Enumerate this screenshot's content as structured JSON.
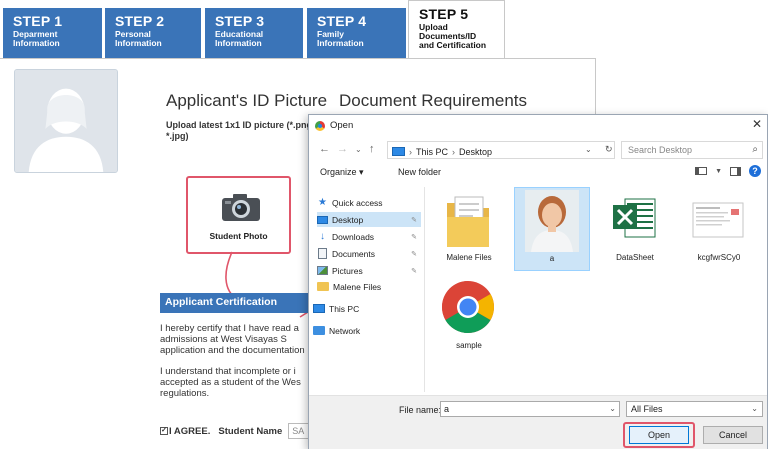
{
  "steps": [
    {
      "num": "STEP 1",
      "sub": "Deparment\nInformation"
    },
    {
      "num": "STEP 2",
      "sub": "Personal\nInformation"
    },
    {
      "num": "STEP 3",
      "sub": "Educational\nInformation"
    },
    {
      "num": "STEP 4",
      "sub": "Family\nInformation"
    },
    {
      "num": "STEP 5",
      "sub": "Upload\nDocuments/ID\nand Certification"
    }
  ],
  "headings": {
    "id_picture": "Applicant's ID Picture",
    "document_requirements": "Document Requirements"
  },
  "upload_note": "Upload latest 1x1 ID picture (*.png, *.jpg)",
  "student_photo_label": "Student Photo",
  "certification": {
    "title": "Applicant Certification",
    "p1": "I hereby certify that I have read a\nadmissions at West Visayas S\napplication and the documentation",
    "p2": "I understand that incomplete or i\naccepted as a student of the Wes\nregulations.",
    "agree": "I AGREE.",
    "student_name_label": "Student Name",
    "student_name_value": "SA"
  },
  "dialog": {
    "title": "Open",
    "nav": {
      "back": "←",
      "forward": "→",
      "dropdown": "⌄",
      "up": "↑"
    },
    "breadcrumb": [
      "This PC",
      "Desktop"
    ],
    "search_placeholder": "Search Desktop",
    "organize": "Organize ▾",
    "new_folder": "New folder",
    "sidebar": [
      {
        "label": "Quick access",
        "icon": "star-icon",
        "pinned": false
      },
      {
        "label": "Desktop",
        "icon": "desktop-icon",
        "pinned": true
      },
      {
        "label": "Downloads",
        "icon": "downloads-icon",
        "pinned": true
      },
      {
        "label": "Documents",
        "icon": "documents-icon",
        "pinned": true
      },
      {
        "label": "Pictures",
        "icon": "pictures-icon",
        "pinned": true
      },
      {
        "label": "Malene Files",
        "icon": "folder-icon",
        "pinned": false
      },
      {
        "label": "This PC",
        "icon": "pc-icon",
        "pinned": false
      },
      {
        "label": "Network",
        "icon": "network-icon",
        "pinned": false
      }
    ],
    "files": [
      {
        "name": "Malene Files",
        "type": "folder"
      },
      {
        "name": "a",
        "type": "photo",
        "selected": true
      },
      {
        "name": "DataSheet",
        "type": "excel"
      },
      {
        "name": "kcgfwrSCy0",
        "type": "document"
      },
      {
        "name": "sample",
        "type": "chrome"
      }
    ],
    "file_name_label": "File name:",
    "file_name_value": "a",
    "file_type": "All Files",
    "open_label": "Open",
    "cancel_label": "Cancel"
  },
  "colors": {
    "step_blue": "#3a74b8",
    "highlight_red": "#e0566a",
    "selection_blue": "#cce4f7"
  }
}
